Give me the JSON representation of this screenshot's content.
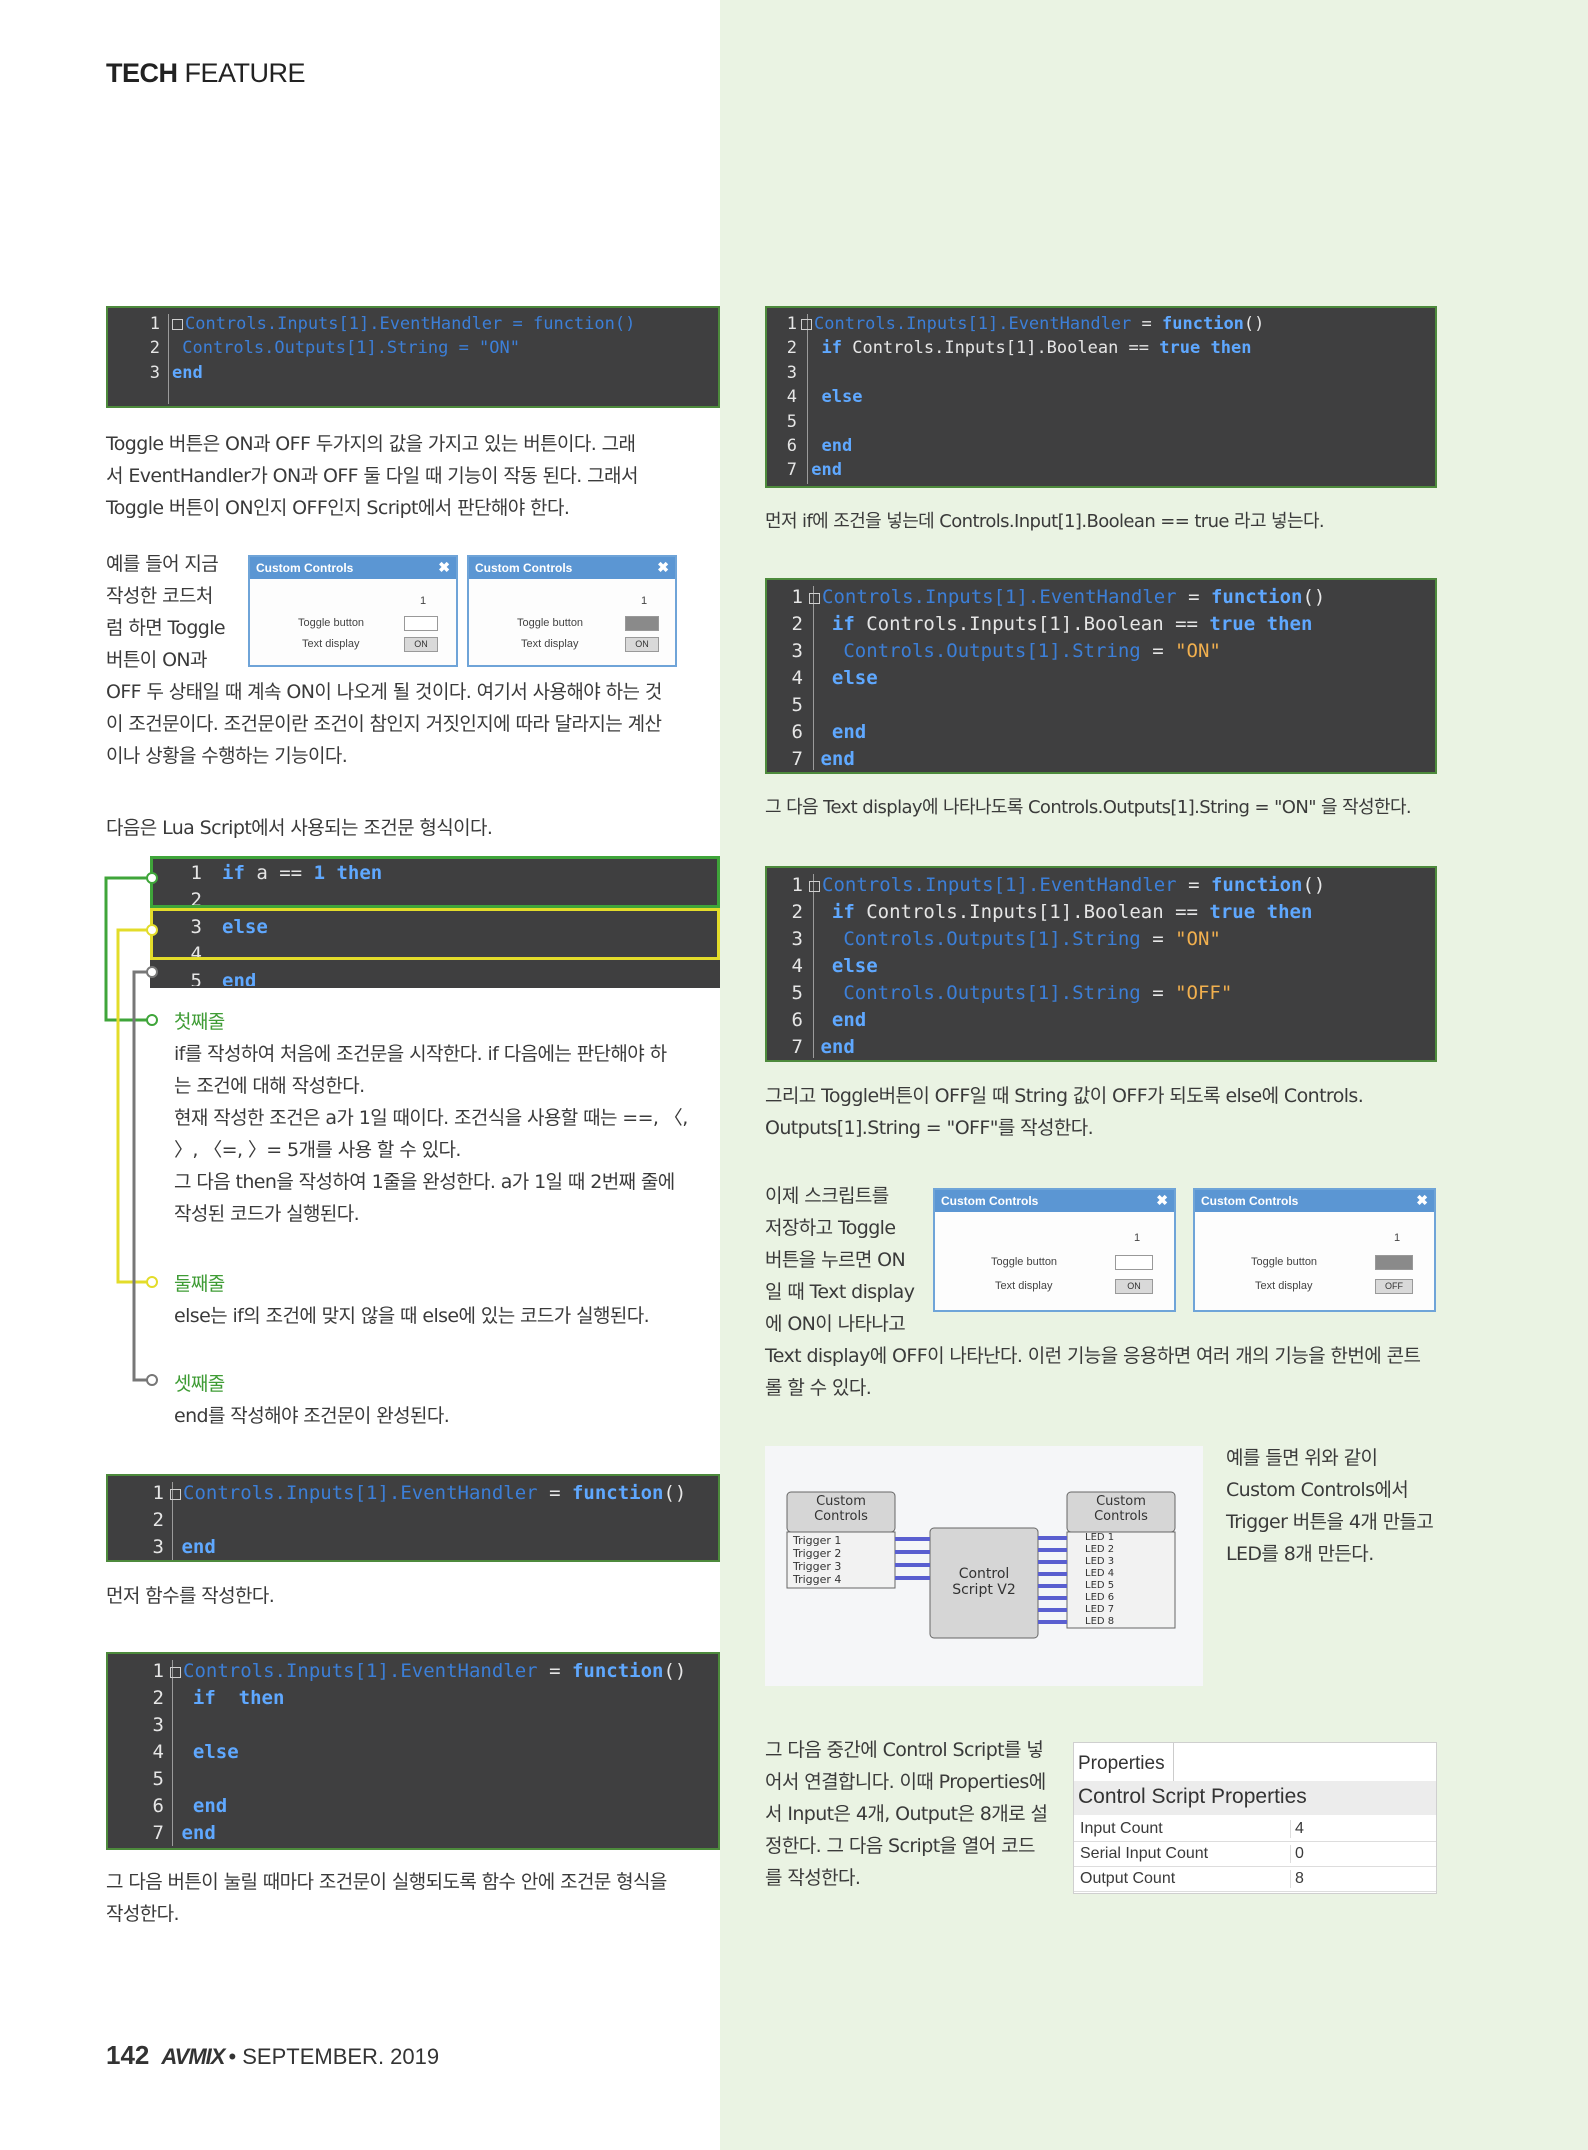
{
  "header": {
    "bold": "TECH",
    "light": " FEATURE"
  },
  "code1": {
    "lines": [
      "Controls.Inputs[1].EventHandler = function()",
      " Controls.Outputs[1].String = \"ON\"",
      "end"
    ]
  },
  "para1": {
    "lines": [
      "Toggle 버튼은 ON과 OFF 두가지의 값을 가지고 있는 버튼이다. 그래",
      "서 EventHandler가 ON과 OFF 둘 다일 때 기능이 작동 된다. 그래서",
      "Toggle 버튼이 ON인지 OFF인지 Script에서 판단해야 한다."
    ]
  },
  "para2": {
    "lines": [
      "예를 들어 지금",
      "작성한 코드처",
      "럼 하면 Toggle",
      "버튼이 ON과"
    ]
  },
  "para2b": {
    "lines": [
      "OFF 두 상태일 때 계속 ON이 나오게 될 것이다. 여기서 사용해야 하는 것",
      "이 조건문이다. 조건문이란 조건이 참인지 거짓인지에 따라 달라지는 계산",
      "이나 상황을 수행하는 기능이다."
    ]
  },
  "window_a": {
    "title": "Custom Controls",
    "close": "✖",
    "num": "1",
    "toggle_label": "Toggle button",
    "display_label": "Text display",
    "display_value": "ON"
  },
  "window_b": {
    "title": "Custom Controls",
    "close": "✖",
    "num": "1",
    "toggle_label": "Toggle button",
    "display_label": "Text display",
    "display_value": "ON"
  },
  "para3": {
    "text": "다음은 Lua Script에서 사용되는 조건문 형식이다."
  },
  "lua": {
    "nums": [
      "1",
      "2",
      "3",
      "4",
      "5"
    ]
  },
  "sec1": {
    "title": "첫째줄",
    "lines": [
      "if를 작성하여 처음에 조건문을 시작한다. if 다음에는 판단해야 하",
      "는 조건에 대해 작성한다.",
      "현재 작성한 조건은 a가 1일 때이다. 조건식을 사용할 때는 ==, 〈,",
      "〉, 〈=, 〉= 5개를 사용 할 수 있다.",
      "그 다음 then을 작성하여 1줄을 완성한다. a가 1일 때 2번째 줄에",
      "작성된 코드가 실행된다."
    ]
  },
  "sec2": {
    "title": "둘째줄",
    "text": "else는 if의 조건에 맞지 않을 때 else에 있는 코드가 실행된다."
  },
  "sec3": {
    "title": "셋째줄",
    "text": "end를 작성해야 조건문이 완성된다."
  },
  "cap4": {
    "text": "먼저 함수를 작성한다."
  },
  "cap5": {
    "lines": [
      "그 다음 버튼이 눌릴 때마다 조건문이 실행되도록 함수 안에 조건문 형식을",
      "작성한다."
    ]
  },
  "rcap1": {
    "text": "먼저 if에 조건을 넣는데 Controls.Input[1].Boolean == true 라고 넣는다."
  },
  "rcap2": {
    "text": "그 다음 Text display에 나타나도록 Controls.Outputs[1].String = \"ON\" 을 작성한다."
  },
  "rcap3": {
    "lines": [
      "그리고 Toggle버튼이 OFF일 때 String 값이 OFF가 되도록 else에 Controls.",
      "Outputs[1].String = \"OFF\"를 작성한다."
    ]
  },
  "rpara4": {
    "lines": [
      "이제 스크립트를",
      "저장하고 Toggle",
      "버튼을 누르면 ON",
      "일 때 Text display",
      "에 ON이 나타나고"
    ]
  },
  "rpara4b": {
    "lines": [
      "Text display에 OFF이 나타난다. 이런 기능을 응용하면 여러 개의 기능을 한번에 콘트",
      "롤 할 수 있다."
    ]
  },
  "window_c": {
    "title": "Custom Controls",
    "close": "✖",
    "num": "1",
    "toggle_label": "Toggle button",
    "display_label": "Text display",
    "display_value": "ON"
  },
  "window_d": {
    "title": "Custom Controls",
    "close": "✖",
    "num": "1",
    "toggle_label": "Toggle button",
    "display_label": "Text display",
    "display_value": "OFF"
  },
  "diagram": {
    "left_title": "Custom\nControls",
    "triggers": [
      "Trigger 1",
      "Trigger 2",
      "Trigger 3",
      "Trigger 4"
    ],
    "center": "Control\nScript V2",
    "right_title": "Custom\nControls",
    "leds": [
      "LED 1",
      "LED 2",
      "LED 3",
      "LED 4",
      "LED 5",
      "LED 6",
      "LED 7",
      "LED 8"
    ]
  },
  "rpara5": {
    "lines": [
      "예를 들면 위와 같이",
      "Custom Controls에서",
      "Trigger 버튼을 4개 만들고",
      "LED를 8개 만든다."
    ]
  },
  "rpara6": {
    "lines": [
      "그 다음 중간에 Control Script를 넣",
      "어서 연결합니다. 이때 Properties에",
      "서 Input은 4개, Output은 8개로 설",
      "정한다. 그 다음 Script을 열어 코드",
      "를 작성한다."
    ]
  },
  "props": {
    "tab": "Properties",
    "title": "Control Script Properties",
    "rows": [
      [
        "Input Count",
        "4"
      ],
      [
        "Serial Input Count",
        "0"
      ],
      [
        "Output Count",
        "8"
      ]
    ]
  },
  "footer": {
    "page": "142",
    "logo": "AVMIX",
    "date": "• SEPTEMBER. 2019"
  }
}
